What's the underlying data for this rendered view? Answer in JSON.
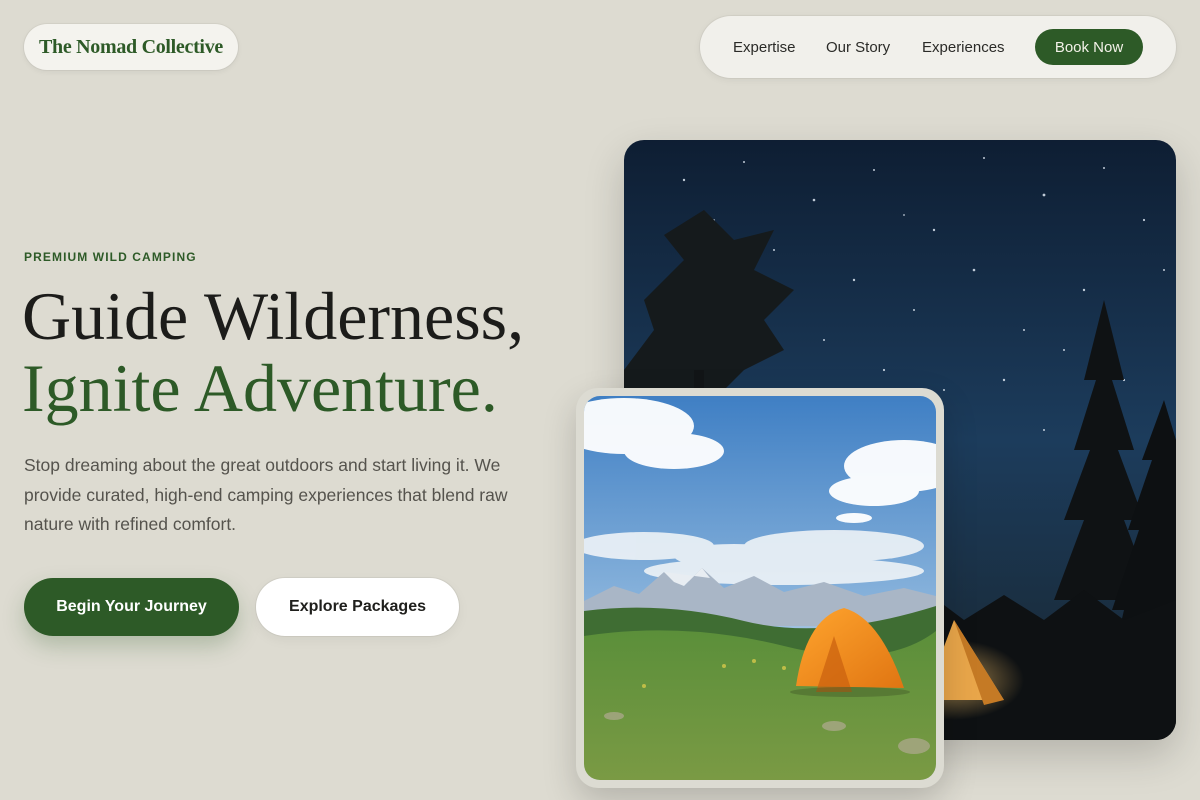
{
  "brand": {
    "name": "The Nomad Collective"
  },
  "nav": {
    "links": [
      "Expertise",
      "Our Story",
      "Experiences"
    ],
    "cta": "Book Now"
  },
  "hero": {
    "eyebrow": "PREMIUM WILD CAMPING",
    "headline_line1": "Guide Wilderness,",
    "headline_line2": "Ignite Adventure.",
    "lead": "Stop dreaming about the great outdoors and start living it. We provide curated, high-end camping experiences that blend raw nature with refined comfort.",
    "primary_cta": "Begin Your Journey",
    "secondary_cta": "Explore Packages"
  },
  "images": {
    "night_photo": "starry-night-tent-photo",
    "day_photo": "mountain-meadow-tent-photo"
  },
  "colors": {
    "background": "#dddbd1",
    "accent_green": "#2d5a27",
    "tent_orange": "#f08a1c"
  }
}
